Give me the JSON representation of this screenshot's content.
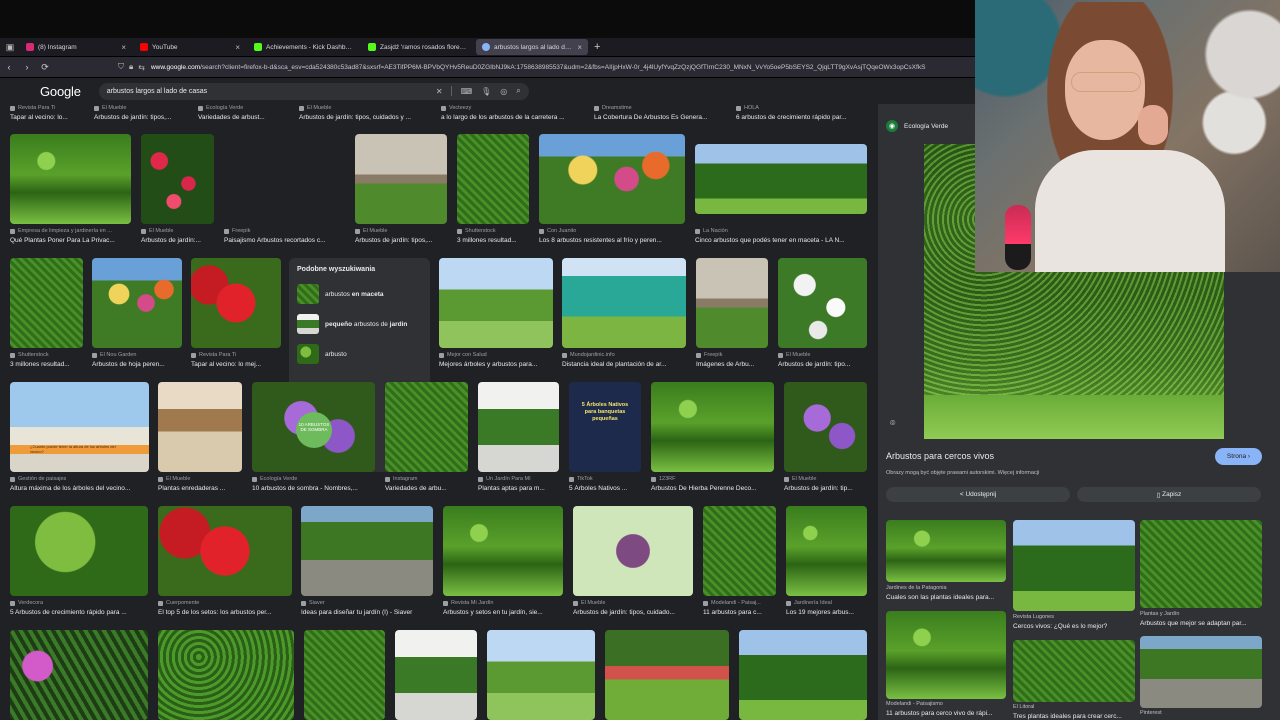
{
  "tabs": [
    {
      "label": "(8) Instagram",
      "fav_color": "#d62976",
      "active": false
    },
    {
      "label": "YouTube",
      "fav_color": "#ff0000",
      "active": false
    },
    {
      "label": "Achievements - Kick Dashboard",
      "fav_color": "#53fc18",
      "active": false
    },
    {
      "label": "Zasjdź 'ramos rosados flores' e",
      "fav_color": "#53fc18",
      "active": false
    },
    {
      "label": "arbustos largos al lado de casa",
      "fav_color": "#8ab4f8",
      "active": true
    }
  ],
  "navbar": {
    "url_domain": "www.google.com",
    "url_rest": "/search?client=firefox-b-d&sca_esv=cda524380c53ad87&sxsrf=AE3TifPP6M-BPVbQYHv5ReuD0ZGIbNJ9kA:1758638985537&udm=2&fbs=AIIjpHxW-0r_4j4lUyfYvqZzQzjQGfTIrnC230_MNxN_VvYo5oeP5bSEYS2_QjqLTT9gXvAsjTQqeOWx3opCsXfkS"
  },
  "header": {
    "logo": "Google",
    "query": "arbustos largos al lado de casas"
  },
  "related": {
    "title": "Podobne wyszukiwania",
    "items": [
      {
        "prefix": "arbustos ",
        "bold": "en maceta",
        "suffix": ""
      },
      {
        "prefix": "",
        "bold": "pequeño",
        "suffix": " arbustos de ",
        "bold2": "jardin"
      },
      {
        "prefix": "arbusto",
        "bold": "",
        "suffix": ""
      }
    ]
  },
  "results": {
    "row0": [
      {
        "src": "Revista Para Ti",
        "title": "Tapar al vecino: lo..."
      },
      {
        "src": "El Mueble",
        "title": "Arbustos de jardín: tipos,..."
      },
      {
        "src": "Ecología Verde",
        "title": "Variedades de arbust..."
      },
      {
        "src": "El Mueble",
        "title": "Arbustos de jardín: tipos, cuidados y ..."
      },
      {
        "src": "Vecteezy",
        "title": "a lo largo de los arbustos de la carretera ..."
      },
      {
        "src": "Dreamstime",
        "title": "La Cobertura De Arbustos Es Genera..."
      },
      {
        "src": "HOLA",
        "title": "6 arbustos de crecimiento rápido par..."
      }
    ],
    "row1": [
      {
        "src": "Empresa de limpieza y jardinería en ...",
        "title": "Qué Plantas Poner Para La Privac..."
      },
      {
        "src": "El Mueble",
        "title": "Arbustos de jardín:..."
      },
      {
        "src": "Freepik",
        "title": "Paisajismo Arbustos recortados c..."
      },
      {
        "src": "El Mueble",
        "title": "Arbustos de jardín: tipos,..."
      },
      {
        "src": "Shutterstock",
        "title": "3 millones resultad..."
      },
      {
        "src": "Con Juanito",
        "title": "Los 8 arbustos resistentes al frío y peren..."
      },
      {
        "src": "La Nación",
        "title": "Cinco arbustos que podés tener en maceta - LA N..."
      }
    ],
    "row2": [
      {
        "src": "Shutterstock",
        "title": "3 millones resultad..."
      },
      {
        "src": "El Nou Garden",
        "title": "Arbustos de hoja peren..."
      },
      {
        "src": "Revista Para Ti",
        "title": "Tapar al vecino: lo mej..."
      },
      {
        "src": "Mejor con Salud",
        "title": "Mejores árboles y arbustos para..."
      },
      {
        "src": "Mundojardinic.info",
        "title": "Distancia ideal de plantación de ar..."
      },
      {
        "src": "Freepik",
        "title": "Imágenes de Arbu..."
      },
      {
        "src": "El Mueble",
        "title": "Arbustos de jardín: tipo..."
      }
    ],
    "row3": [
      {
        "src": "Gestión de paisajes",
        "title": "Altura máxima de los árboles del vecino..."
      },
      {
        "src": "El Mueble",
        "title": "Plantas enredaderas ..."
      },
      {
        "src": "Ecología Verde",
        "title": "10 arbustos de sombra - Nombres,..."
      },
      {
        "src": "Instagram",
        "title": "Variedades de arbu..."
      },
      {
        "src": "Un Jardín Para Mí",
        "title": "Plantas aptas para m..."
      },
      {
        "src": "TikTok",
        "title": "5 Árboles Nativos ..."
      },
      {
        "src": "123RF",
        "title": "Arbustos De Hierba Perenne Deco..."
      },
      {
        "src": "El Mueble",
        "title": "Arbustos de jardín: tip..."
      }
    ],
    "row4": [
      {
        "src": "Verdecora",
        "title": "5 Arbustos de crecimiento rápido para ..."
      },
      {
        "src": "Cuerpomente",
        "title": "El top 5 de los setos: los arbustos per..."
      },
      {
        "src": "Siaver",
        "title": "Ideas para diseñar tu jardín (I) - Siaver"
      },
      {
        "src": "Revista Mi Jardín",
        "title": "Arbustos y setos en tu jardín, sie..."
      },
      {
        "src": "El Mueble",
        "title": "Arbustos de jardín: tipos, cuidado..."
      },
      {
        "src": "Modelandi - Paisaj...",
        "title": "11 arbustos para c..."
      },
      {
        "src": "Jardinería Ideal",
        "title": "Los 19 mejores arbus..."
      }
    ],
    "poster_text": "5 Árboles Nativos para banquetas pequeñas",
    "badge_text": "¿Cuanto puede tener la altura de los árboles del vecino?",
    "wheel_text": "10 ARBUSTOS DE SOMBRA"
  },
  "panel": {
    "source": "Ecología Verde",
    "title": "Arbustos para cercos vivos",
    "visit": "Strona",
    "copyright": "Obrazy mogą być objęte prawami autorskimi. Więcej informacji",
    "share": "Udostępnij",
    "save": "Zapisz",
    "related": [
      {
        "src": "Jardines de la Patagonia",
        "title": "Cuales son las plantas ideales para..."
      },
      {
        "src": "Revista Lugones",
        "title": "Cercos vivos: ¿Qué es lo mejor?"
      },
      {
        "src": "Plantas y Jardín",
        "title": "Arbustos que mejor se adaptan par..."
      },
      {
        "src": "Modelandi - Paisajismo",
        "title": "11 arbustos para cerco vivo de rápi..."
      },
      {
        "src": "El Litoral",
        "title": "Tres plantas ideales para crear cerc..."
      },
      {
        "src": "Pinterest",
        "title": ""
      }
    ]
  },
  "icons": {
    "back": "arrow-left-icon",
    "forward": "arrow-right-icon",
    "reload": "reload-icon",
    "clear": "close-icon",
    "mic": "mic-icon",
    "lens": "lens-icon",
    "search": "search-icon"
  }
}
